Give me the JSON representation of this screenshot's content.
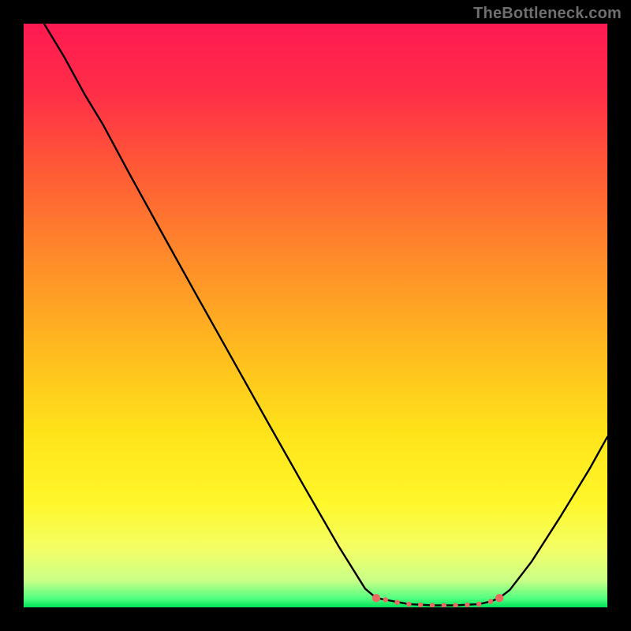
{
  "watermark": "TheBottleneck.com",
  "chart_data": {
    "type": "line",
    "title": "",
    "xlabel": "",
    "ylabel": "",
    "xlim": [
      0,
      100
    ],
    "ylim": [
      0,
      100
    ],
    "grid": false,
    "legend": false,
    "background_gradient_stops": [
      {
        "offset": 0.0,
        "color": "#ff1a52"
      },
      {
        "offset": 0.12,
        "color": "#ff2e47"
      },
      {
        "offset": 0.25,
        "color": "#ff5a36"
      },
      {
        "offset": 0.4,
        "color": "#ff8a2a"
      },
      {
        "offset": 0.55,
        "color": "#ffb81f"
      },
      {
        "offset": 0.7,
        "color": "#ffe31a"
      },
      {
        "offset": 0.82,
        "color": "#fff72a"
      },
      {
        "offset": 0.9,
        "color": "#f4ff66"
      },
      {
        "offset": 0.955,
        "color": "#c8ff88"
      },
      {
        "offset": 0.985,
        "color": "#4fff7f"
      },
      {
        "offset": 1.0,
        "color": "#00e25b"
      }
    ],
    "series": [
      {
        "name": "bottleneck-curve",
        "stroke": "#000000",
        "points": [
          {
            "x": 3.5,
            "y": 100.0
          },
          {
            "x": 7.0,
            "y": 94.2
          },
          {
            "x": 10.5,
            "y": 87.8
          },
          {
            "x": 13.6,
            "y": 82.7
          },
          {
            "x": 18.0,
            "y": 74.5
          },
          {
            "x": 24.0,
            "y": 63.6
          },
          {
            "x": 30.0,
            "y": 52.8
          },
          {
            "x": 36.0,
            "y": 42.1
          },
          {
            "x": 42.0,
            "y": 31.4
          },
          {
            "x": 48.0,
            "y": 20.8
          },
          {
            "x": 54.0,
            "y": 10.4
          },
          {
            "x": 58.5,
            "y": 3.2
          },
          {
            "x": 60.4,
            "y": 1.6
          },
          {
            "x": 62.0,
            "y": 1.3
          },
          {
            "x": 66.0,
            "y": 0.55
          },
          {
            "x": 70.0,
            "y": 0.35
          },
          {
            "x": 74.0,
            "y": 0.35
          },
          {
            "x": 78.0,
            "y": 0.55
          },
          {
            "x": 80.0,
            "y": 1.0
          },
          {
            "x": 81.5,
            "y": 1.6
          },
          {
            "x": 83.3,
            "y": 3.0
          },
          {
            "x": 87.0,
            "y": 7.8
          },
          {
            "x": 92.0,
            "y": 15.6
          },
          {
            "x": 97.0,
            "y": 23.8
          },
          {
            "x": 100.0,
            "y": 29.2
          }
        ]
      }
    ],
    "markers": {
      "color": "#e86b61",
      "radii": {
        "end": 5.2,
        "mid": 3.2
      },
      "points": [
        {
          "x": 60.4,
          "y": 1.6,
          "kind": "end"
        },
        {
          "x": 62.0,
          "y": 1.3,
          "kind": "mid"
        },
        {
          "x": 64.0,
          "y": 0.85,
          "kind": "mid"
        },
        {
          "x": 66.0,
          "y": 0.55,
          "kind": "mid"
        },
        {
          "x": 68.0,
          "y": 0.42,
          "kind": "mid"
        },
        {
          "x": 70.0,
          "y": 0.35,
          "kind": "mid"
        },
        {
          "x": 72.0,
          "y": 0.33,
          "kind": "mid"
        },
        {
          "x": 74.0,
          "y": 0.35,
          "kind": "mid"
        },
        {
          "x": 76.0,
          "y": 0.42,
          "kind": "mid"
        },
        {
          "x": 78.0,
          "y": 0.55,
          "kind": "mid"
        },
        {
          "x": 80.0,
          "y": 1.0,
          "kind": "mid"
        },
        {
          "x": 81.5,
          "y": 1.6,
          "kind": "end"
        }
      ]
    }
  }
}
